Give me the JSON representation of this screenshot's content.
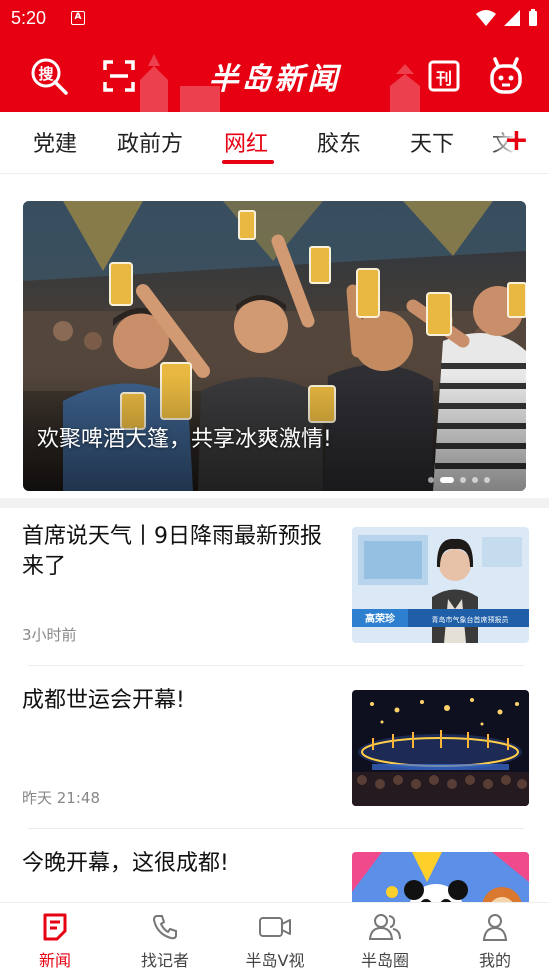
{
  "status_bar": {
    "time": "5:20",
    "notification_glyph": "A"
  },
  "header": {
    "logo_text": "半岛新闻",
    "icons": [
      "search-icon",
      "scan-icon",
      "epaper-icon",
      "mascot-icon"
    ],
    "search_glyph": "搜",
    "epaper_glyph": "刊"
  },
  "tabs": {
    "items": [
      "党建",
      "政前方",
      "网红",
      "胶东",
      "天下",
      "文"
    ],
    "active": "网红",
    "add_label": "+"
  },
  "banner": {
    "caption": "欢聚啤酒大篷，共享冰爽激情!",
    "dots": 5,
    "active_dot": 2
  },
  "news": [
    {
      "title": "首席说天气丨9日降雨最新预报来了",
      "meta": "3小时前",
      "thumb": {
        "name_tag": "高荣珍",
        "caption": "青岛市气象台首席预报员"
      }
    },
    {
      "title": "成都世运会开幕!",
      "meta": "昨天 21:48"
    },
    {
      "title": "今晚开幕，这很成都!",
      "meta": ""
    }
  ],
  "bottom_nav": {
    "items": [
      {
        "label": "新闻",
        "icon": "news-icon",
        "active": true
      },
      {
        "label": "找记者",
        "icon": "phone-icon",
        "active": false
      },
      {
        "label": "半岛V视",
        "icon": "video-icon",
        "active": false
      },
      {
        "label": "半岛圈",
        "icon": "people-icon",
        "active": false
      },
      {
        "label": "我的",
        "icon": "profile-icon",
        "active": false
      }
    ]
  },
  "colors": {
    "brand_red": "#e60012",
    "text": "#111111",
    "meta": "#888888"
  }
}
